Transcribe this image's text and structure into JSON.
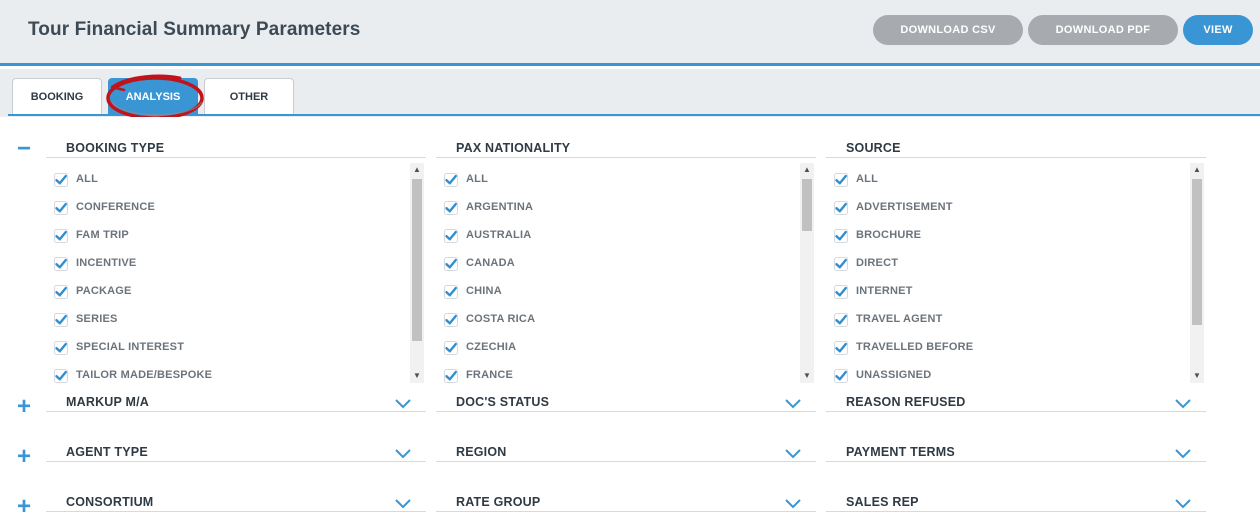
{
  "header": {
    "title": "Tour Financial Summary Parameters",
    "download_csv": "DOWNLOAD CSV",
    "download_pdf": "DOWNLOAD PDF",
    "view": "VIEW"
  },
  "tabs": [
    {
      "label": "BOOKING",
      "active": false
    },
    {
      "label": "ANALYSIS",
      "active": true
    },
    {
      "label": "OTHER",
      "active": false
    }
  ],
  "colors": {
    "accent": "#3a95d4",
    "annotation": "#c0141c",
    "button_grey": "#a7abaf"
  },
  "icons": {
    "collapse": "minus-icon",
    "expand": "plus-icon",
    "dropdown": "chevron-down-icon",
    "check": "checkbox-checked-icon"
  },
  "expanded_row": {
    "booking_type": {
      "title": "BOOKING TYPE",
      "items": [
        "ALL",
        "CONFERENCE",
        "FAM TRIP",
        "INCENTIVE",
        "PACKAGE",
        "SERIES",
        "SPECIAL INTEREST",
        "TAILOR MADE/BESPOKE"
      ]
    },
    "pax_nationality": {
      "title": "PAX NATIONALITY",
      "items": [
        "ALL",
        "ARGENTINA",
        "AUSTRALIA",
        "CANADA",
        "CHINA",
        "COSTA RICA",
        "CZECHIA",
        "FRANCE"
      ]
    },
    "source": {
      "title": "SOURCE",
      "items": [
        "ALL",
        "ADVERTISEMENT",
        "BROCHURE",
        "DIRECT",
        "INTERNET",
        "TRAVEL AGENT",
        "TRAVELLED BEFORE",
        "UNASSIGNED"
      ]
    }
  },
  "collapsed_rows": [
    [
      "MARKUP M/A",
      "DOC'S STATUS",
      "REASON REFUSED"
    ],
    [
      "AGENT TYPE",
      "REGION",
      "PAYMENT TERMS"
    ],
    [
      "CONSORTIUM",
      "RATE GROUP",
      "SALES REP"
    ]
  ],
  "toggle_symbols": {
    "collapse": "−",
    "expand": "+"
  },
  "scroll_arrows": {
    "up": "▲",
    "down": "▼"
  }
}
